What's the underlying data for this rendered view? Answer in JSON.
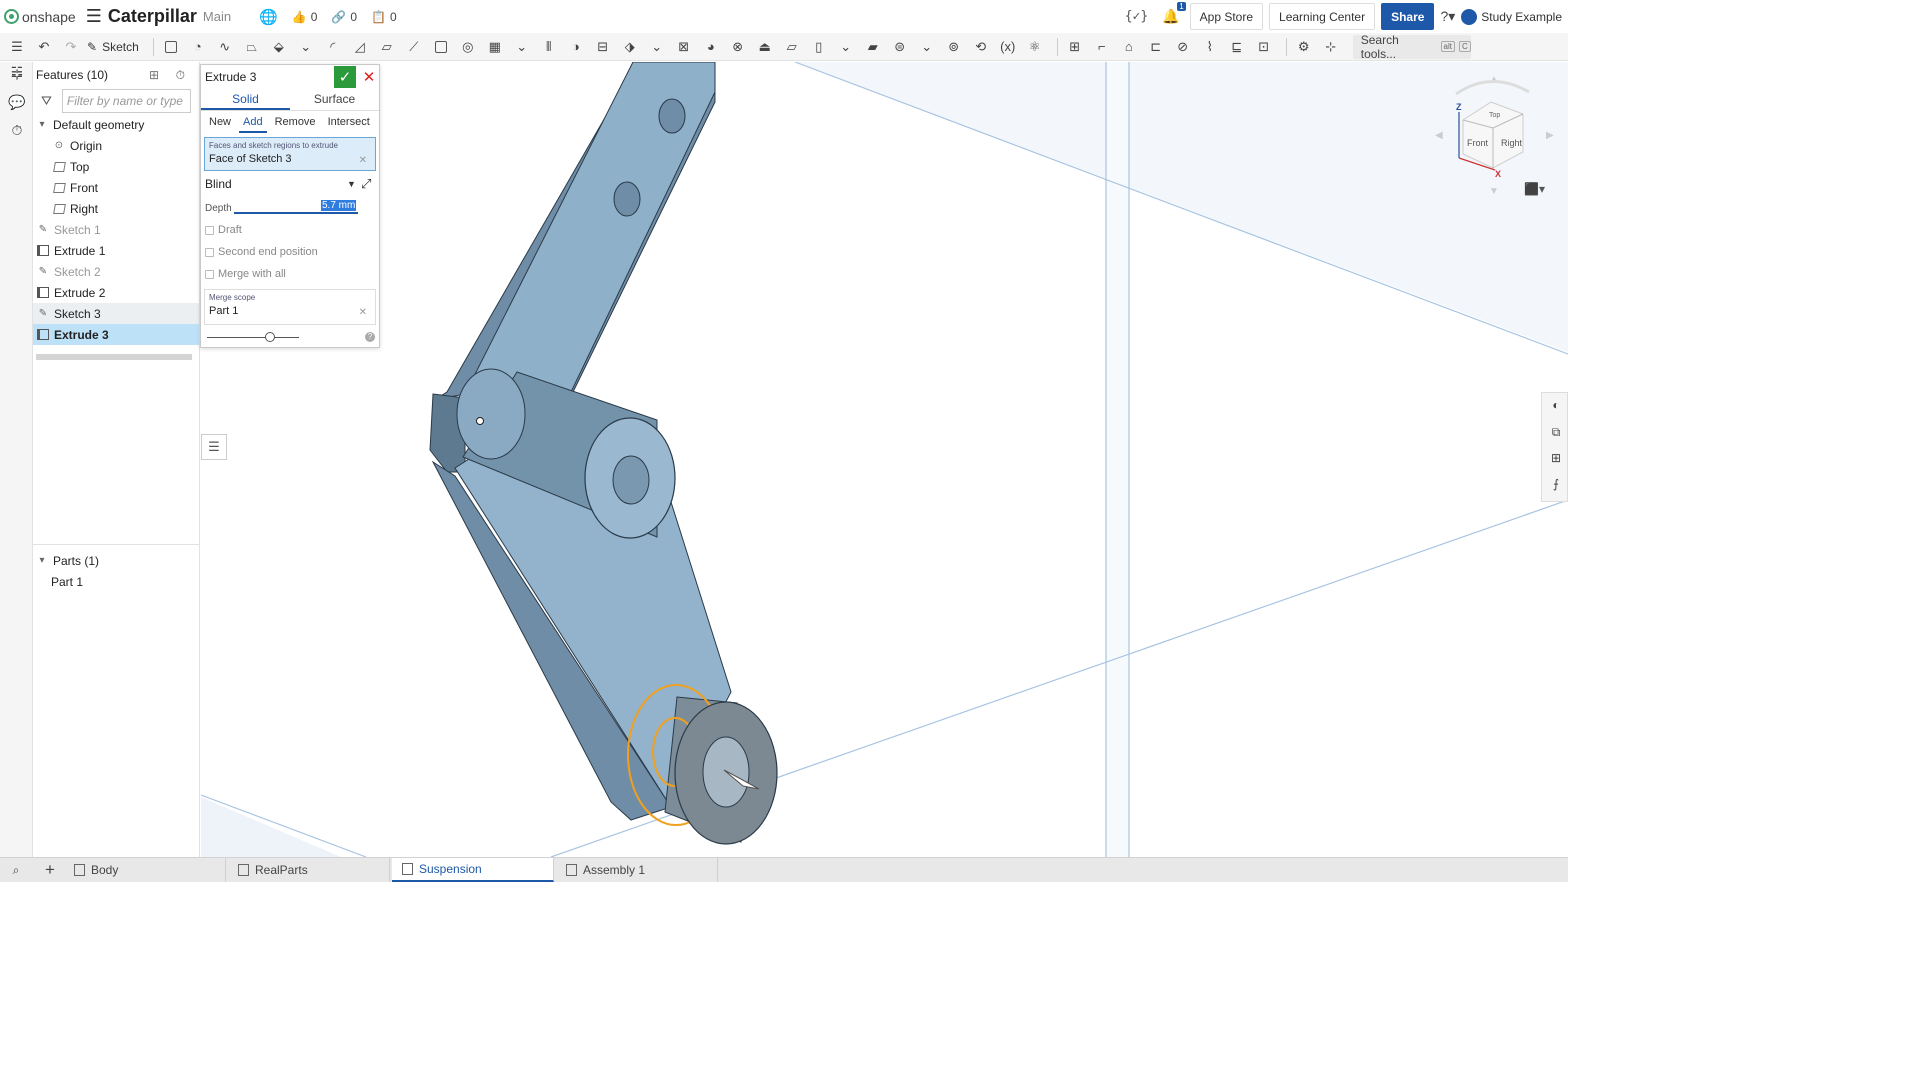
{
  "header": {
    "brand": "onshape",
    "doc_title": "Caterpillar",
    "branch": "Main",
    "likes": "0",
    "links": "0",
    "copies": "0",
    "notifications": "1",
    "app_store": "App Store",
    "learning_center": "Learning Center",
    "share": "Share",
    "user": "Study Example"
  },
  "toolbar": {
    "sketch": "Sketch",
    "search_tools": "Search tools...",
    "search_shortcut_1": "alt",
    "search_shortcut_2": "C"
  },
  "features": {
    "title": "Features (10)",
    "filter_placeholder": "Filter by name or type",
    "default_geometry": "Default geometry",
    "items": [
      {
        "label": "Origin",
        "type": "origin"
      },
      {
        "label": "Top",
        "type": "plane"
      },
      {
        "label": "Front",
        "type": "plane"
      },
      {
        "label": "Right",
        "type": "plane"
      },
      {
        "label": "Sketch 1",
        "type": "sketch"
      },
      {
        "label": "Extrude 1",
        "type": "extrude"
      },
      {
        "label": "Sketch 2",
        "type": "sketch"
      },
      {
        "label": "Extrude 2",
        "type": "extrude"
      },
      {
        "label": "Sketch 3",
        "type": "sketch"
      },
      {
        "label": "Extrude 3",
        "type": "extrude"
      }
    ],
    "parts_title": "Parts (1)",
    "parts": [
      "Part 1"
    ]
  },
  "dialog": {
    "title": "Extrude 3",
    "tabs": [
      "Solid",
      "Surface"
    ],
    "active_tab": "Solid",
    "subtabs": [
      "New",
      "Add",
      "Remove",
      "Intersect"
    ],
    "active_subtab": "Add",
    "faces_caption": "Faces and sketch regions to extrude",
    "faces_value": "Face of Sketch 3",
    "end_type": "Blind",
    "depth_label": "Depth",
    "depth_value": "5.7 mm",
    "draft": "Draft",
    "second_end": "Second end position",
    "merge_all": "Merge with all",
    "merge_scope_caption": "Merge scope",
    "merge_scope_value": "Part 1"
  },
  "viewcube": {
    "top": "Top",
    "front": "Front",
    "right": "Right",
    "z_axis": "Z",
    "x_axis": "X"
  },
  "tabs": [
    {
      "label": "Body"
    },
    {
      "label": "RealParts"
    },
    {
      "label": "Suspension"
    },
    {
      "label": "Assembly 1"
    }
  ],
  "active_tab": "Suspension",
  "colors": {
    "accent": "#1e58a8",
    "ok": "#2a9a3a",
    "cancel": "#dd2222",
    "part_fill": "#8fb0c9",
    "highlight": "#f0a020",
    "selection": "#bde2f7"
  }
}
